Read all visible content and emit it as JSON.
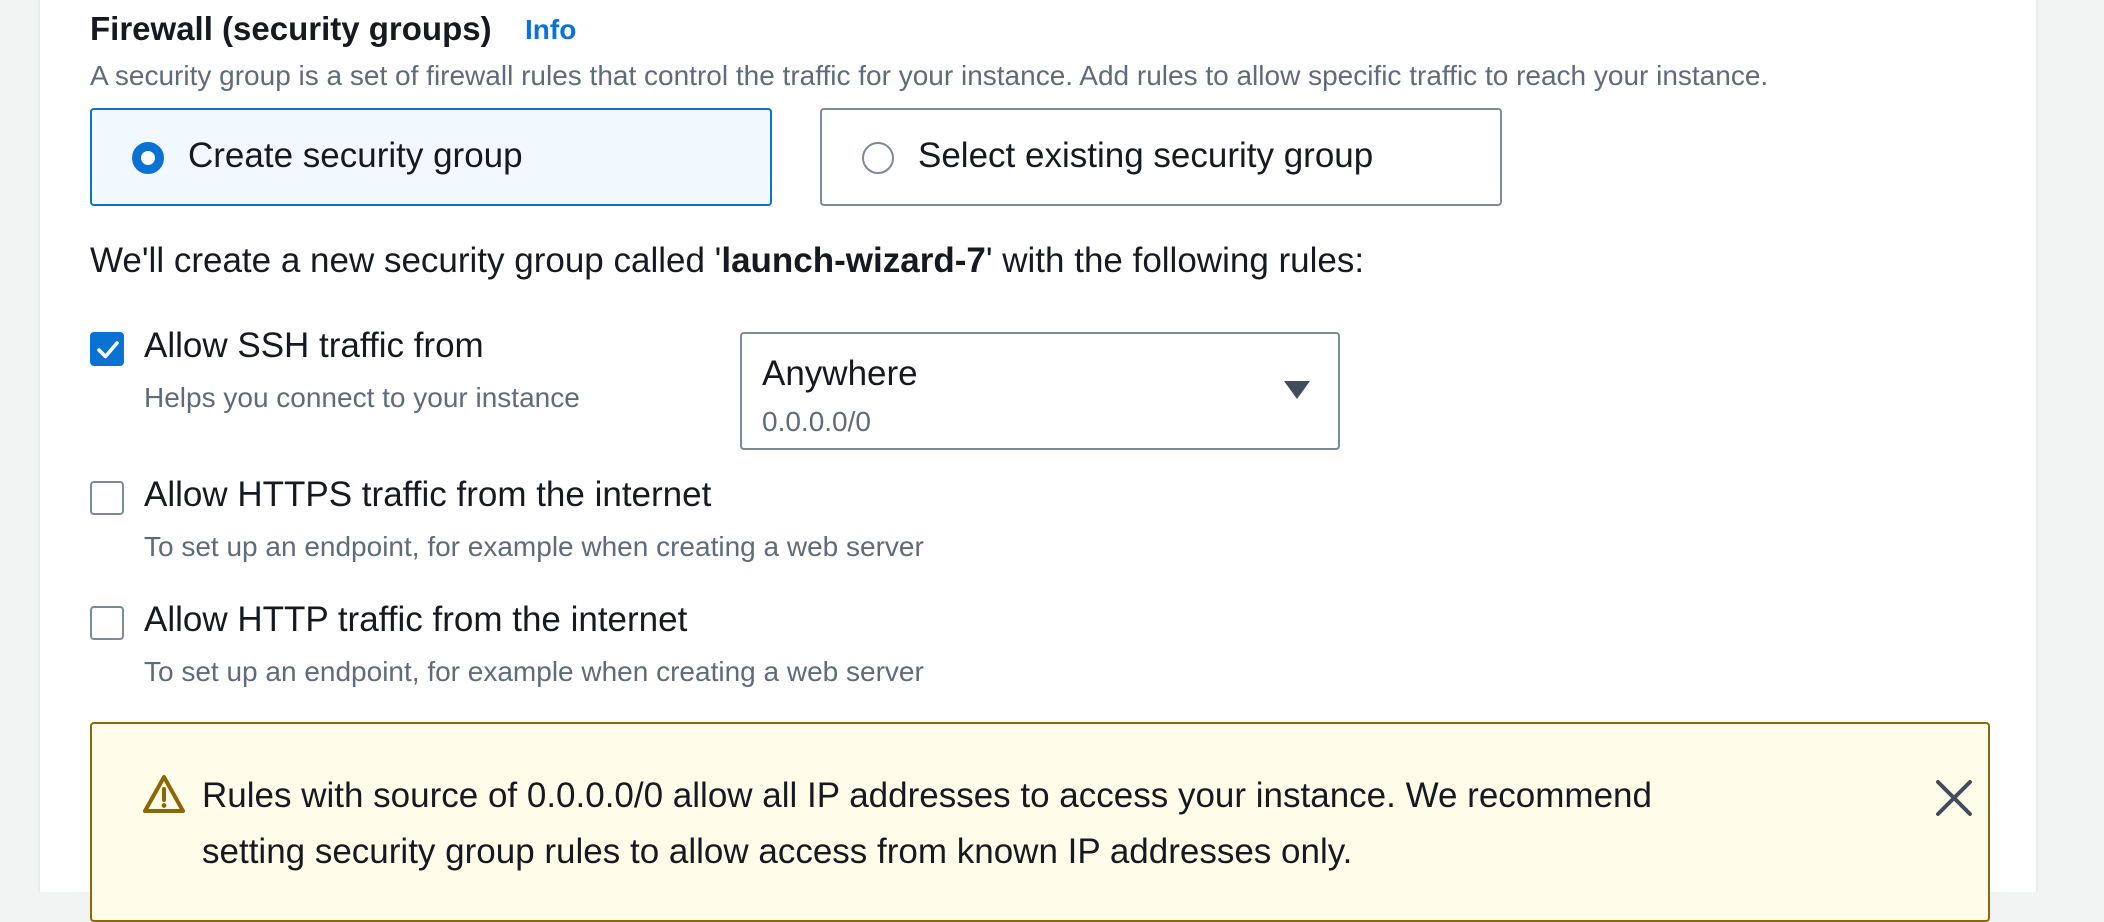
{
  "firewall": {
    "title": "Firewall (security groups)",
    "info_link": "Info",
    "description": "A security group is a set of firewall rules that control the traffic for your instance. Add rules to allow specific traffic to reach your instance.",
    "options": {
      "create": {
        "label": "Create security group",
        "selected": true
      },
      "existing": {
        "label": "Select existing security group",
        "selected": false
      }
    }
  },
  "intro": {
    "prefix": "We'll create a new security group called '",
    "group_name": "launch-wizard-7",
    "suffix": "' with the following rules:"
  },
  "rules": {
    "ssh": {
      "label": "Allow SSH traffic from",
      "description": "Helps you connect to your instance",
      "checked": true,
      "source_select": {
        "value": "Anywhere",
        "cidr": "0.0.0.0/0"
      }
    },
    "https": {
      "label": "Allow HTTPS traffic from the internet",
      "description": "To set up an endpoint, for example when creating a web server",
      "checked": false
    },
    "http": {
      "label": "Allow HTTP traffic from the internet",
      "description": "To set up an endpoint, for example when creating a web server",
      "checked": false
    }
  },
  "warning": {
    "icon": "warning-icon",
    "text": "Rules with source of 0.0.0.0/0 allow all IP addresses to access your instance. We recommend setting security group rules to allow access from known IP addresses only.",
    "close_icon": "close-icon"
  },
  "colors": {
    "accent": "#0972d3",
    "selected_tile_bg": "#f1f9ff",
    "warning_bg": "#fffce9",
    "warning_border": "#8d6605",
    "secondary_text": "#5f6b7a"
  }
}
